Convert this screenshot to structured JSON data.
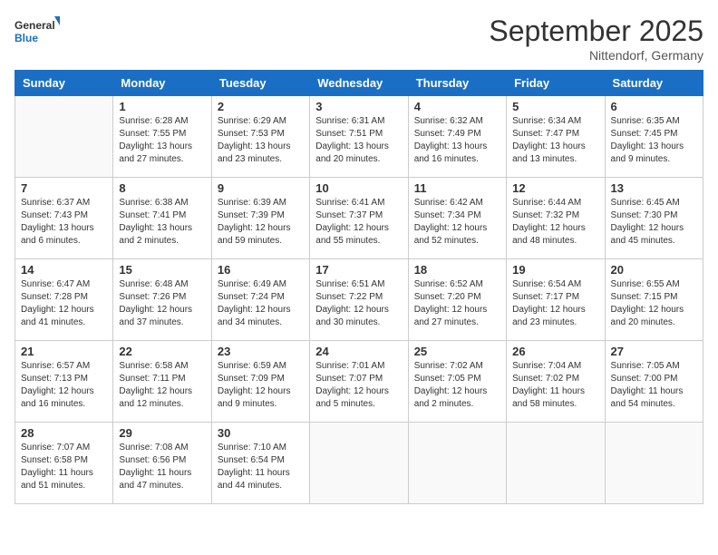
{
  "header": {
    "logo_general": "General",
    "logo_blue": "Blue",
    "title": "September 2025",
    "subtitle": "Nittendorf, Germany"
  },
  "weekdays": [
    "Sunday",
    "Monday",
    "Tuesday",
    "Wednesday",
    "Thursday",
    "Friday",
    "Saturday"
  ],
  "weeks": [
    [
      {
        "day": "",
        "info": ""
      },
      {
        "day": "1",
        "info": "Sunrise: 6:28 AM\nSunset: 7:55 PM\nDaylight: 13 hours and 27 minutes."
      },
      {
        "day": "2",
        "info": "Sunrise: 6:29 AM\nSunset: 7:53 PM\nDaylight: 13 hours and 23 minutes."
      },
      {
        "day": "3",
        "info": "Sunrise: 6:31 AM\nSunset: 7:51 PM\nDaylight: 13 hours and 20 minutes."
      },
      {
        "day": "4",
        "info": "Sunrise: 6:32 AM\nSunset: 7:49 PM\nDaylight: 13 hours and 16 minutes."
      },
      {
        "day": "5",
        "info": "Sunrise: 6:34 AM\nSunset: 7:47 PM\nDaylight: 13 hours and 13 minutes."
      },
      {
        "day": "6",
        "info": "Sunrise: 6:35 AM\nSunset: 7:45 PM\nDaylight: 13 hours and 9 minutes."
      }
    ],
    [
      {
        "day": "7",
        "info": "Sunrise: 6:37 AM\nSunset: 7:43 PM\nDaylight: 13 hours and 6 minutes."
      },
      {
        "day": "8",
        "info": "Sunrise: 6:38 AM\nSunset: 7:41 PM\nDaylight: 13 hours and 2 minutes."
      },
      {
        "day": "9",
        "info": "Sunrise: 6:39 AM\nSunset: 7:39 PM\nDaylight: 12 hours and 59 minutes."
      },
      {
        "day": "10",
        "info": "Sunrise: 6:41 AM\nSunset: 7:37 PM\nDaylight: 12 hours and 55 minutes."
      },
      {
        "day": "11",
        "info": "Sunrise: 6:42 AM\nSunset: 7:34 PM\nDaylight: 12 hours and 52 minutes."
      },
      {
        "day": "12",
        "info": "Sunrise: 6:44 AM\nSunset: 7:32 PM\nDaylight: 12 hours and 48 minutes."
      },
      {
        "day": "13",
        "info": "Sunrise: 6:45 AM\nSunset: 7:30 PM\nDaylight: 12 hours and 45 minutes."
      }
    ],
    [
      {
        "day": "14",
        "info": "Sunrise: 6:47 AM\nSunset: 7:28 PM\nDaylight: 12 hours and 41 minutes."
      },
      {
        "day": "15",
        "info": "Sunrise: 6:48 AM\nSunset: 7:26 PM\nDaylight: 12 hours and 37 minutes."
      },
      {
        "day": "16",
        "info": "Sunrise: 6:49 AM\nSunset: 7:24 PM\nDaylight: 12 hours and 34 minutes."
      },
      {
        "day": "17",
        "info": "Sunrise: 6:51 AM\nSunset: 7:22 PM\nDaylight: 12 hours and 30 minutes."
      },
      {
        "day": "18",
        "info": "Sunrise: 6:52 AM\nSunset: 7:20 PM\nDaylight: 12 hours and 27 minutes."
      },
      {
        "day": "19",
        "info": "Sunrise: 6:54 AM\nSunset: 7:17 PM\nDaylight: 12 hours and 23 minutes."
      },
      {
        "day": "20",
        "info": "Sunrise: 6:55 AM\nSunset: 7:15 PM\nDaylight: 12 hours and 20 minutes."
      }
    ],
    [
      {
        "day": "21",
        "info": "Sunrise: 6:57 AM\nSunset: 7:13 PM\nDaylight: 12 hours and 16 minutes."
      },
      {
        "day": "22",
        "info": "Sunrise: 6:58 AM\nSunset: 7:11 PM\nDaylight: 12 hours and 12 minutes."
      },
      {
        "day": "23",
        "info": "Sunrise: 6:59 AM\nSunset: 7:09 PM\nDaylight: 12 hours and 9 minutes."
      },
      {
        "day": "24",
        "info": "Sunrise: 7:01 AM\nSunset: 7:07 PM\nDaylight: 12 hours and 5 minutes."
      },
      {
        "day": "25",
        "info": "Sunrise: 7:02 AM\nSunset: 7:05 PM\nDaylight: 12 hours and 2 minutes."
      },
      {
        "day": "26",
        "info": "Sunrise: 7:04 AM\nSunset: 7:02 PM\nDaylight: 11 hours and 58 minutes."
      },
      {
        "day": "27",
        "info": "Sunrise: 7:05 AM\nSunset: 7:00 PM\nDaylight: 11 hours and 54 minutes."
      }
    ],
    [
      {
        "day": "28",
        "info": "Sunrise: 7:07 AM\nSunset: 6:58 PM\nDaylight: 11 hours and 51 minutes."
      },
      {
        "day": "29",
        "info": "Sunrise: 7:08 AM\nSunset: 6:56 PM\nDaylight: 11 hours and 47 minutes."
      },
      {
        "day": "30",
        "info": "Sunrise: 7:10 AM\nSunset: 6:54 PM\nDaylight: 11 hours and 44 minutes."
      },
      {
        "day": "",
        "info": ""
      },
      {
        "day": "",
        "info": ""
      },
      {
        "day": "",
        "info": ""
      },
      {
        "day": "",
        "info": ""
      }
    ]
  ]
}
